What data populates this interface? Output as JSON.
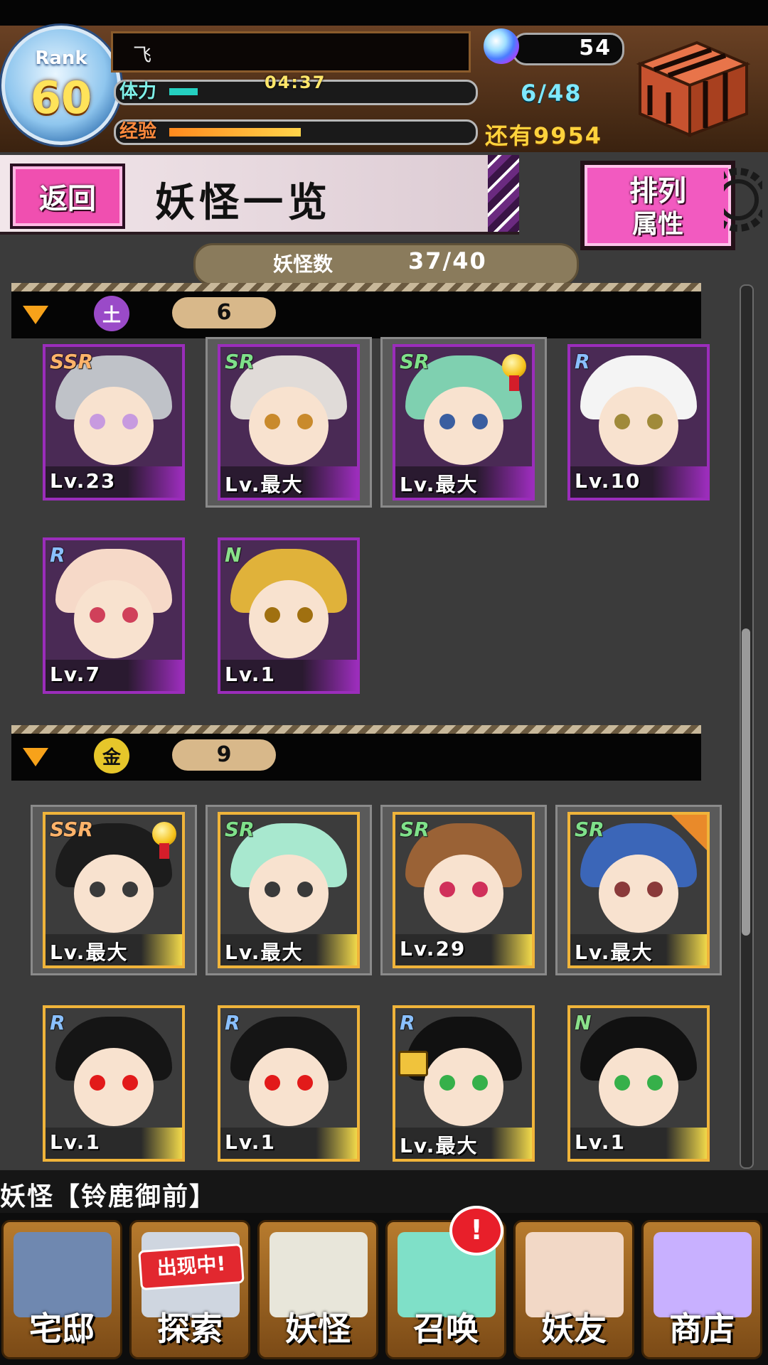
{
  "header": {
    "rank_label": "Rank",
    "rank_value": "60",
    "player_name": "飞",
    "stamina_label": "体力",
    "stamina_timer": "04:37",
    "stamina_fill": 0.08,
    "exp_label": "经验",
    "exp_fill": 0.37,
    "orb_count": "54",
    "count_display": "6/48",
    "remaining": "还有9954"
  },
  "title_bar": {
    "back_label": "返回",
    "title": "妖怪一览",
    "sort_line1": "排列",
    "sort_line2": "属性"
  },
  "monster_count": {
    "label": "妖怪数",
    "value": "37/40"
  },
  "groups": [
    {
      "icon": "earth-element-icon",
      "icon_glyph": "土",
      "icon_color": "#9a4ac8",
      "count": "6",
      "cards": [
        {
          "rarity": "SSR",
          "level": "Lv.23",
          "hair": "#bfc2c8",
          "eye": "#c79adf",
          "framed": false,
          "medal": false
        },
        {
          "rarity": "SR",
          "level": "Lv.最大",
          "hair": "#e0dbd8",
          "eye": "#c98a2c",
          "framed": true,
          "medal": false
        },
        {
          "rarity": "SR",
          "level": "Lv.最大",
          "hair": "#7fd0b0",
          "eye": "#3a5ea0",
          "framed": true,
          "medal": true
        },
        {
          "rarity": "R",
          "level": "Lv.10",
          "hair": "#f4f4f4",
          "eye": "#a08a3a",
          "framed": false,
          "medal": false
        },
        {
          "rarity": "R",
          "level": "Lv.7",
          "hair": "#f6d9c8",
          "eye": "#d0405a",
          "framed": false,
          "medal": false
        },
        {
          "rarity": "N",
          "level": "Lv.1",
          "hair": "#e0b23a",
          "eye": "#a07010",
          "framed": false,
          "medal": false
        }
      ]
    },
    {
      "icon": "gold-element-icon",
      "icon_glyph": "金",
      "icon_color": "#e6c62a",
      "count": "9",
      "cards": [
        {
          "rarity": "SSR",
          "level": "Lv.最大",
          "hair": "#1c1c1c",
          "eye": "#3a3a3a",
          "framed": true,
          "medal": true
        },
        {
          "rarity": "SR",
          "level": "Lv.最大",
          "hair": "#a8e8cf",
          "eye": "#3a3a3a",
          "framed": true,
          "medal": false
        },
        {
          "rarity": "SR",
          "level": "Lv.29",
          "hair": "#9a6236",
          "eye": "#d0305a",
          "framed": true,
          "medal": false
        },
        {
          "rarity": "SR",
          "level": "Lv.最大",
          "hair": "#3b66b8",
          "eye": "#8a3a3a",
          "framed": true,
          "medal": false,
          "star": true
        },
        {
          "rarity": "R",
          "level": "Lv.1",
          "hair": "#151515",
          "eye": "#e21a1a",
          "framed": false,
          "medal": false
        },
        {
          "rarity": "R",
          "level": "Lv.1",
          "hair": "#151515",
          "eye": "#e21a1a",
          "framed": false,
          "medal": false
        },
        {
          "rarity": "R",
          "level": "Lv.最大",
          "hair": "#111111",
          "eye": "#36b04a",
          "framed": false,
          "medal": false,
          "lock": true
        },
        {
          "rarity": "N",
          "level": "Lv.1",
          "hair": "#111111",
          "eye": "#36b04a",
          "framed": false,
          "medal": false
        }
      ]
    }
  ],
  "ticker": "妖怪【铃鹿御前】",
  "nav": [
    {
      "label": "宅邸",
      "icon": "house-icon",
      "color": "#6f88b0"
    },
    {
      "label": "探索",
      "icon": "explore-icon",
      "color": "#cfd6e0",
      "tag": "出现中!"
    },
    {
      "label": "妖怪",
      "icon": "scroll-icon",
      "color": "#e8e6da"
    },
    {
      "label": "召唤",
      "icon": "pentagram-icon",
      "color": "#7fe0c8",
      "badge": "!"
    },
    {
      "label": "妖友",
      "icon": "friend-icon",
      "color": "#f2d8c6"
    },
    {
      "label": "商店",
      "icon": "crystal-orb-icon",
      "color": "#c8b0ff"
    }
  ],
  "colors": {
    "rarity_ssr": "#ffb36a",
    "rarity_sr": "#7fe08a",
    "rarity_r": "#8ac0ff",
    "rarity_n": "#8ae08a",
    "frame_purple": "#9b2dbb",
    "frame_gold": "#f0b43a"
  }
}
